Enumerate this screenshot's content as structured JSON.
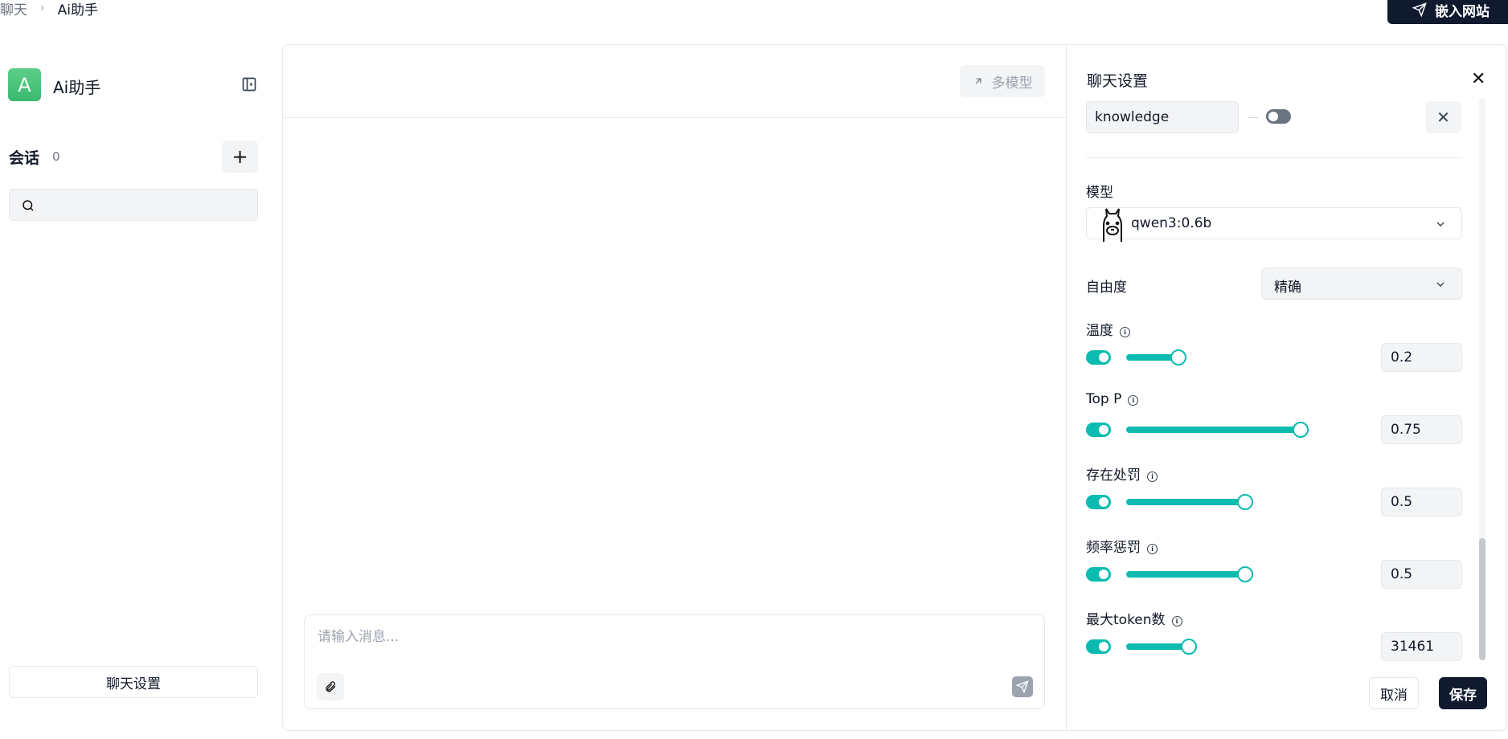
{
  "breadcrumb": {
    "root": "聊天",
    "current": "Ai助手"
  },
  "embed_button": "嵌入网站",
  "sidebar": {
    "app_initial": "A",
    "app_name": "Ai助手",
    "sessions_title": "会话",
    "sessions_count": "0",
    "search_placeholder": "",
    "chat_settings_button": "聊天设置"
  },
  "chat": {
    "multi_model_button": "多模型",
    "input_placeholder": "请输入消息..."
  },
  "settings": {
    "title": "聊天设置",
    "knowledge_value": "knowledge",
    "model_label": "模型",
    "model_value": "qwen3:0.6b",
    "freedom_label": "自由度",
    "freedom_value": "精确",
    "params": [
      {
        "label": "温度",
        "value": "0.2",
        "enabled": true
      },
      {
        "label": "Top P",
        "value": "0.75",
        "enabled": true
      },
      {
        "label": "存在处罚",
        "value": "0.5",
        "enabled": true
      },
      {
        "label": "频率惩罚",
        "value": "0.5",
        "enabled": true
      },
      {
        "label": "最大token数",
        "value": "31461",
        "enabled": true
      }
    ],
    "cancel_button": "取消",
    "save_button": "保存"
  },
  "colors": {
    "accent": "#0bbbb0",
    "primary_dark": "#0f1a2e",
    "avatar_green": "#4cc47c"
  }
}
